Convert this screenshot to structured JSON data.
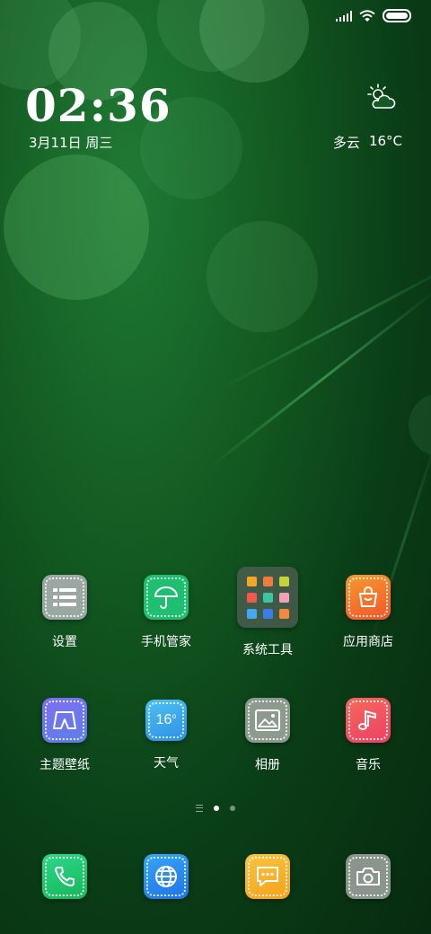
{
  "status_bar": {
    "signal_icon": "signal-icon",
    "wifi_icon": "wifi-icon",
    "battery_icon": "battery-icon"
  },
  "clock": {
    "time": "02:36",
    "date": "3月11日 周三"
  },
  "weather": {
    "condition": "多云",
    "temperature": "16°C",
    "icon": "partly-cloudy-icon"
  },
  "apps": [
    {
      "label": "设置",
      "icon": "settings-icon",
      "color": "#9aa7a2"
    },
    {
      "label": "手机管家",
      "icon": "umbrella-icon",
      "color": "#1fbf72"
    },
    {
      "label": "系统工具",
      "icon": "folder-icon",
      "color": "#4f5f56"
    },
    {
      "label": "应用商店",
      "icon": "shopping-bag-icon",
      "color": "#f47a2a"
    },
    {
      "label": "主题壁纸",
      "icon": "theme-icon",
      "color": "#6f6fe6"
    },
    {
      "label": "天气",
      "icon": "weather-app-icon",
      "color": "#3fb5f0",
      "tile_text": "16"
    },
    {
      "label": "相册",
      "icon": "gallery-icon",
      "color": "#8d9a8e"
    },
    {
      "label": "音乐",
      "icon": "music-note-icon",
      "color": "#f24f5c"
    }
  ],
  "dock": [
    {
      "icon": "phone-icon",
      "color": "#22c86a"
    },
    {
      "icon": "browser-icon",
      "color": "#2a8cf0"
    },
    {
      "icon": "messages-icon",
      "color": "#f7b52c"
    },
    {
      "icon": "camera-icon",
      "color": "#8a968d"
    }
  ],
  "pager": {
    "pages": 2,
    "active": 1
  }
}
